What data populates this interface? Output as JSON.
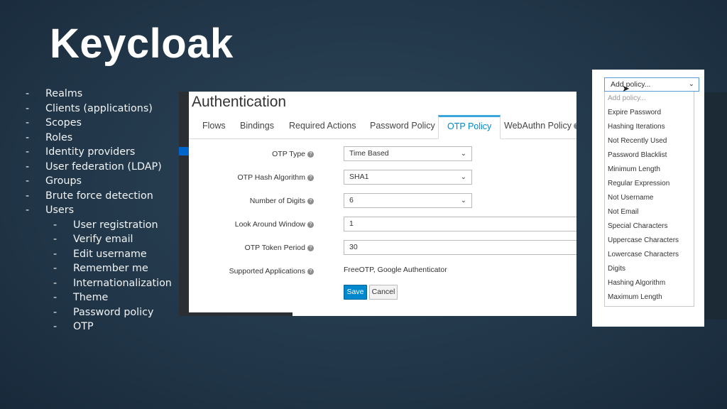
{
  "slide": {
    "title": "Keycloak",
    "bullets": [
      "Realms",
      "Clients (applications)",
      "Scopes",
      "Roles",
      "Identity providers",
      "User federation (LDAP)",
      "Groups",
      "Brute force detection",
      "Users"
    ],
    "sub_bullets": [
      "User registration",
      "Verify email",
      "Edit username",
      "Remember me",
      "Internationalization",
      "Theme",
      "Password policy",
      "OTP"
    ]
  },
  "auth": {
    "title": "Authentication",
    "tabs": [
      "Flows",
      "Bindings",
      "Required Actions",
      "Password Policy",
      "OTP Policy",
      "WebAuthn Policy"
    ],
    "active_tab": "OTP Policy",
    "form": {
      "otp_type": {
        "label": "OTP Type",
        "value": "Time Based"
      },
      "hash_algorithm": {
        "label": "OTP Hash Algorithm",
        "value": "SHA1"
      },
      "digits": {
        "label": "Number of Digits",
        "value": "6"
      },
      "look_around": {
        "label": "Look Around Window",
        "value": "1"
      },
      "token_period": {
        "label": "OTP Token Period",
        "value": "30"
      },
      "supported_apps": {
        "label": "Supported Applications",
        "value": "FreeOTP, Google Authenticator"
      }
    },
    "save_label": "Save",
    "cancel_label": "Cancel"
  },
  "policy_dropdown": {
    "selected": "Add policy...",
    "options": [
      "Add policy...",
      "Expire Password",
      "Hashing Iterations",
      "Not Recently Used",
      "Password Blacklist",
      "Minimum Length",
      "Regular Expression",
      "Not Username",
      "Not Email",
      "Special Characters",
      "Uppercase Characters",
      "Lowercase Characters",
      "Digits",
      "Hashing Algorithm",
      "Maximum Length"
    ]
  },
  "icons": {
    "help": "question-circle-icon",
    "chevron": "chevron-down-icon",
    "cursor": "mouse-pointer-icon"
  },
  "colors": {
    "accent": "#0088ce",
    "background": "#22384a",
    "active_tab_border": "#39a5dc"
  }
}
